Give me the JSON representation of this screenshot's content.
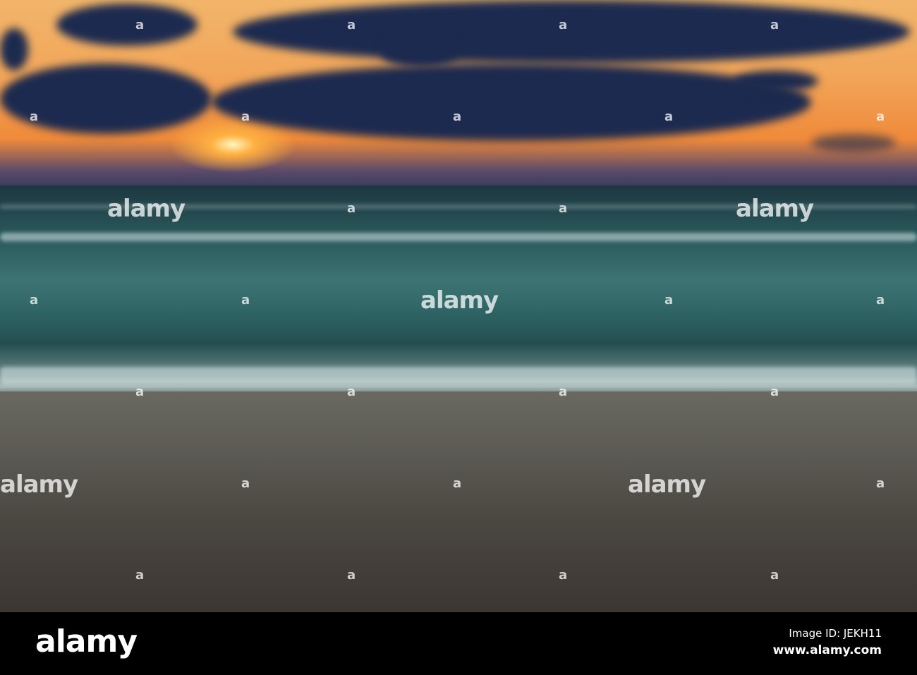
{
  "watermark": {
    "text": "alamy",
    "mark": "a"
  },
  "footer": {
    "logo": "alamy",
    "image_id": "Image ID: JEKH11",
    "url": "www.alamy.com"
  }
}
